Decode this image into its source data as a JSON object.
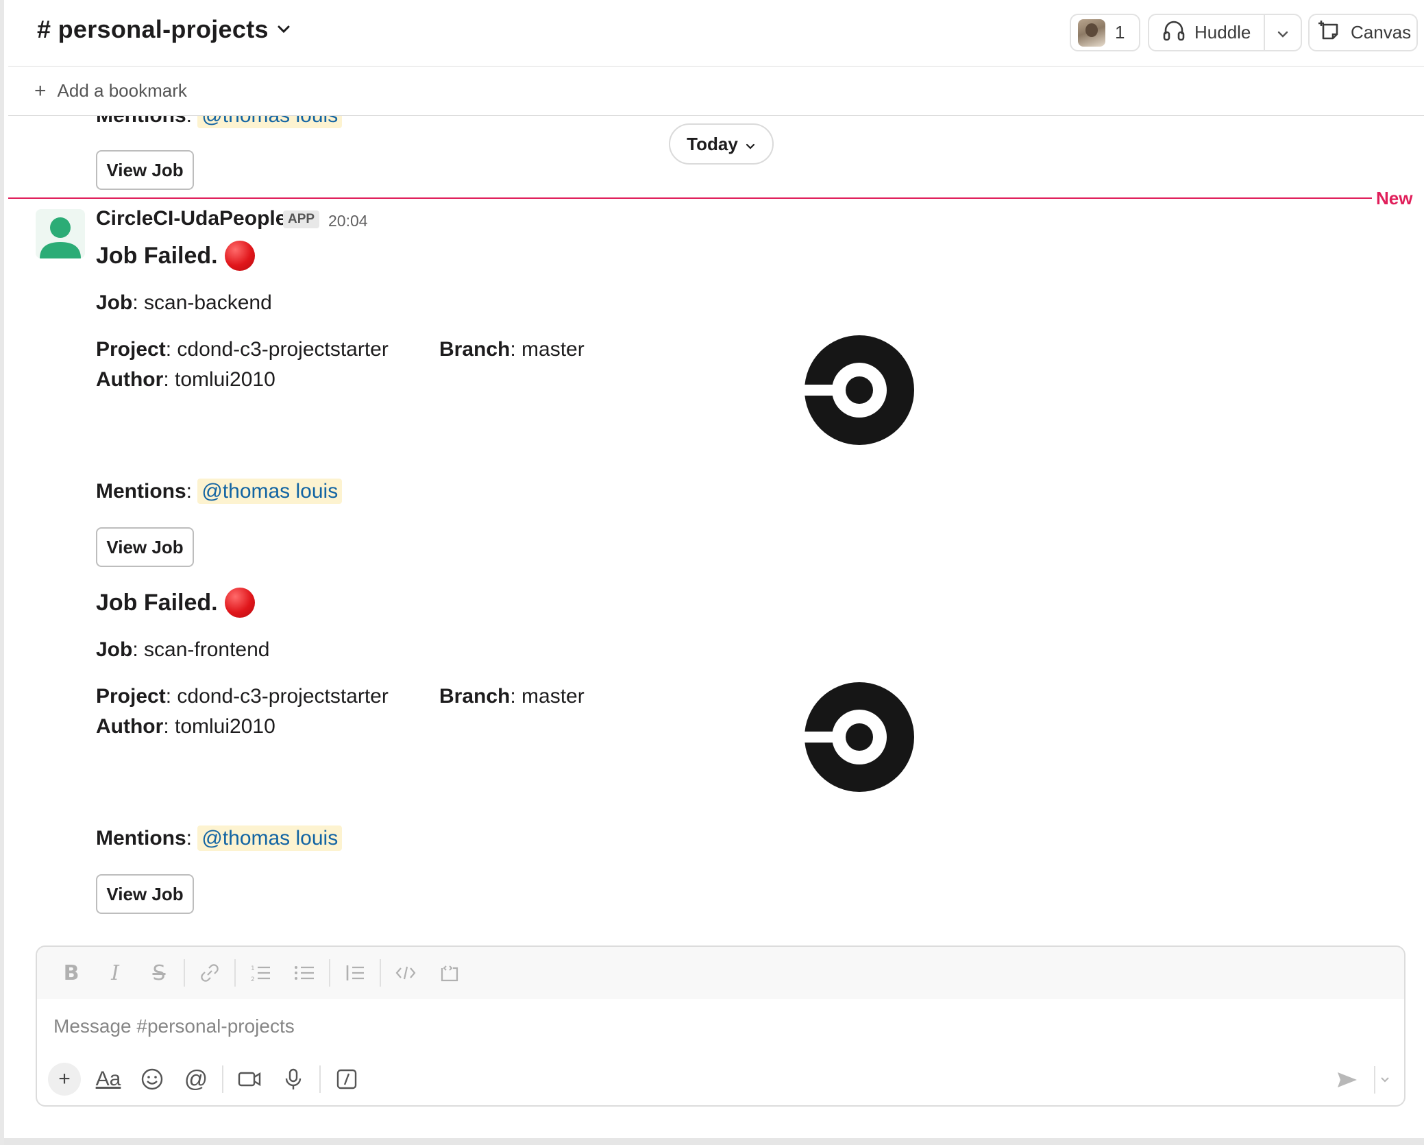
{
  "header": {
    "channel_name": "# personal-projects",
    "member_count": "1",
    "huddle_label": "Huddle",
    "canvas_label": "Canvas"
  },
  "bookmark": {
    "add_label": "Add a bookmark"
  },
  "date_pill": "Today",
  "new_label": "New",
  "previous": {
    "mentions_label": "Mentions",
    "mention": "@thomas louis",
    "view_job": "View Job"
  },
  "message": {
    "author": "CircleCI-UdaPeople",
    "badge": "APP",
    "time": "20:04",
    "jobs": [
      {
        "title": "Job Failed.",
        "job_label": "Job",
        "job": "scan-backend",
        "project_label": "Project",
        "project": "cdond-c3-projectstarter",
        "branch_label": "Branch",
        "branch": "master",
        "author_label": "Author",
        "author": "tomlui2010",
        "mentions_label": "Mentions",
        "mention": "@thomas louis",
        "view_job": "View Job"
      },
      {
        "title": "Job Failed.",
        "job_label": "Job",
        "job": "scan-frontend",
        "project_label": "Project",
        "project": "cdond-c3-projectstarter",
        "branch_label": "Branch",
        "branch": "master",
        "author_label": "Author",
        "author": "tomlui2010",
        "mentions_label": "Mentions",
        "mention": "@thomas louis",
        "view_job": "View Job"
      }
    ]
  },
  "composer": {
    "placeholder": "Message #personal-projects",
    "format_label": "Aa"
  },
  "colors": {
    "new_divider": "#e01e5a",
    "mention_bg": "#fdf3d0",
    "mention_text": "#1264a3",
    "bot_avatar": "#2bac76"
  }
}
